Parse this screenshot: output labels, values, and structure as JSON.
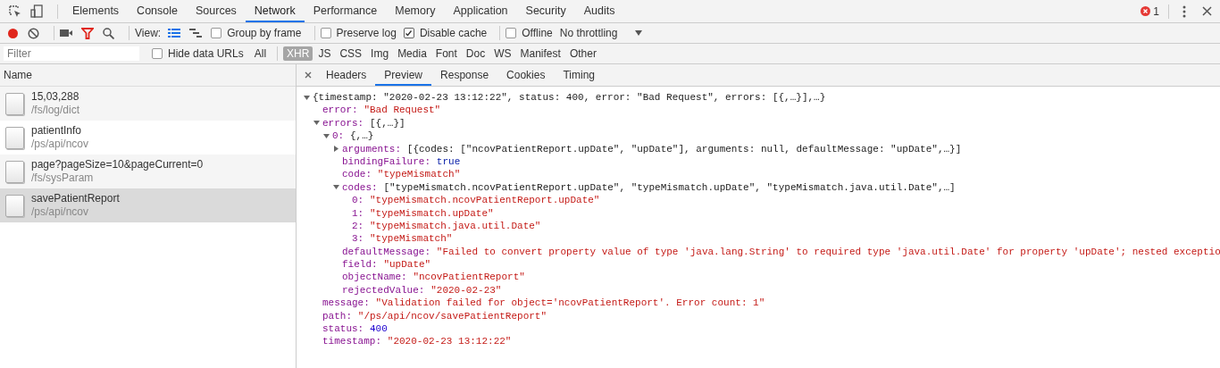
{
  "main_tabs": [
    {
      "label": "Elements",
      "selected": false
    },
    {
      "label": "Console",
      "selected": false
    },
    {
      "label": "Sources",
      "selected": false
    },
    {
      "label": "Network",
      "selected": true
    },
    {
      "label": "Performance",
      "selected": false
    },
    {
      "label": "Memory",
      "selected": false
    },
    {
      "label": "Application",
      "selected": false
    },
    {
      "label": "Security",
      "selected": false
    },
    {
      "label": "Audits",
      "selected": false
    }
  ],
  "error_count": "1",
  "toolbar": {
    "recording": true,
    "filter_active": true,
    "view_label": "View:",
    "view_modes": [
      {
        "kind": "list",
        "selected": true
      },
      {
        "kind": "waterfall",
        "selected": false
      }
    ],
    "options": [
      {
        "label": "Group by frame",
        "checked": false
      },
      {
        "label": "Preserve log",
        "checked": false
      },
      {
        "label": "Disable cache",
        "checked": true
      },
      {
        "label": "Offline",
        "checked": false
      }
    ],
    "throttling": "No throttling"
  },
  "filter_bar": {
    "placeholder": "Filter",
    "hide_data_urls": {
      "label": "Hide data URLs",
      "checked": false
    },
    "types": [
      {
        "label": "All",
        "selected": false
      },
      {
        "label": "XHR",
        "selected": true
      },
      {
        "label": "JS",
        "selected": false
      },
      {
        "label": "CSS",
        "selected": false
      },
      {
        "label": "Img",
        "selected": false
      },
      {
        "label": "Media",
        "selected": false
      },
      {
        "label": "Font",
        "selected": false
      },
      {
        "label": "Doc",
        "selected": false
      },
      {
        "label": "WS",
        "selected": false
      },
      {
        "label": "Manifest",
        "selected": false
      },
      {
        "label": "Other",
        "selected": false
      }
    ]
  },
  "requests": {
    "column": "Name",
    "rows": [
      {
        "name": "15,03,288",
        "path": "/fs/log/dict",
        "selected": false
      },
      {
        "name": "patientInfo",
        "path": "/ps/api/ncov",
        "selected": false
      },
      {
        "name": "page?pageSize=10&pageCurrent=0",
        "path": "/fs/sysParam",
        "selected": false
      },
      {
        "name": "savePatientReport",
        "path": "/ps/api/ncov",
        "selected": true
      }
    ]
  },
  "detail_tabs": [
    {
      "label": "Headers",
      "selected": false
    },
    {
      "label": "Preview",
      "selected": true
    },
    {
      "label": "Response",
      "selected": false
    },
    {
      "label": "Cookies",
      "selected": false
    },
    {
      "label": "Timing",
      "selected": false
    }
  ],
  "preview": {
    "kind": "summary",
    "value": "{timestamp: \"2020-02-23 13:12:22\", status: 400, error: \"Bad Request\", errors: [{,…}],…}",
    "expanded": true,
    "children": [
      {
        "key": "error:",
        "kind": "string",
        "value": "\"Bad Request\""
      },
      {
        "key": "errors:",
        "kind": "summary",
        "value": "[{,…}]",
        "expanded": true,
        "children": [
          {
            "key": "0:",
            "kind": "summary",
            "value": "{,…}",
            "expanded": true,
            "children": [
              {
                "key": "arguments:",
                "kind": "summary",
                "value": "[{codes: [\"ncovPatientReport.upDate\", \"upDate\"], arguments: null, defaultMessage: \"upDate\",…}]",
                "expanded": false
              },
              {
                "key": "bindingFailure:",
                "kind": "boolean",
                "value": "true"
              },
              {
                "key": "code:",
                "kind": "string",
                "value": "\"typeMismatch\""
              },
              {
                "key": "codes:",
                "kind": "summary",
                "value": "[\"typeMismatch.ncovPatientReport.upDate\", \"typeMismatch.upDate\", \"typeMismatch.java.util.Date\",…]",
                "expanded": true,
                "children": [
                  {
                    "key": "0:",
                    "kind": "string",
                    "value": "\"typeMismatch.ncovPatientReport.upDate\""
                  },
                  {
                    "key": "1:",
                    "kind": "string",
                    "value": "\"typeMismatch.upDate\""
                  },
                  {
                    "key": "2:",
                    "kind": "string",
                    "value": "\"typeMismatch.java.util.Date\""
                  },
                  {
                    "key": "3:",
                    "kind": "string",
                    "value": "\"typeMismatch\""
                  }
                ]
              },
              {
                "key": "defaultMessage:",
                "kind": "string",
                "value": "\"Failed to convert property value of type 'java.lang.String' to required type 'java.util.Date' for property 'upDate'; nested exceptio"
              },
              {
                "key": "field:",
                "kind": "string",
                "value": "\"upDate\""
              },
              {
                "key": "objectName:",
                "kind": "string",
                "value": "\"ncovPatientReport\""
              },
              {
                "key": "rejectedValue:",
                "kind": "string",
                "value": "\"2020-02-23\""
              }
            ]
          }
        ]
      },
      {
        "key": "message:",
        "kind": "string",
        "value": "\"Validation failed for object='ncovPatientReport'. Error count: 1\""
      },
      {
        "key": "path:",
        "kind": "string",
        "value": "\"/ps/api/ncov/savePatientReport\""
      },
      {
        "key": "status:",
        "kind": "number",
        "value": "400"
      },
      {
        "key": "timestamp:",
        "kind": "string",
        "value": "\"2020-02-23 13:12:22\""
      }
    ]
  }
}
